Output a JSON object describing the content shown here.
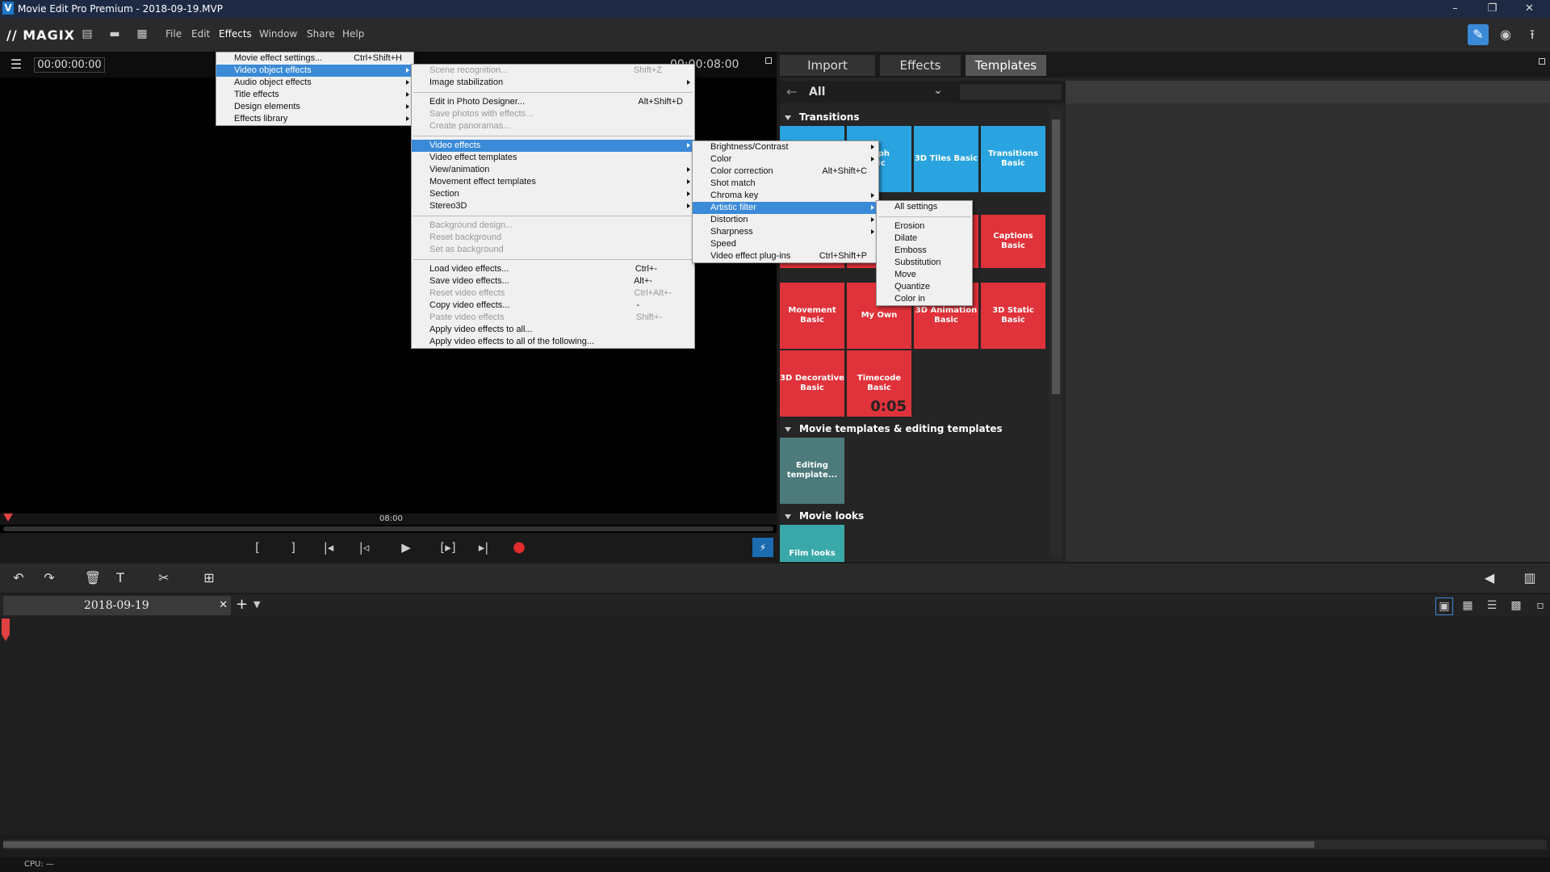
{
  "window": {
    "title": "Movie Edit Pro Premium - 2018-09-19.MVP",
    "app_icon": "V",
    "controls": [
      "–",
      "❐",
      "✕"
    ]
  },
  "menubar": {
    "logo": "// MAGIX",
    "menus": [
      "File",
      "Edit",
      "Effects",
      "Window",
      "Share",
      "Help"
    ],
    "active_menu": "Effects"
  },
  "preview": {
    "timecode": "00:00:00:00",
    "timecode_end": "00:00:08:00",
    "timeline_mark": "08:00"
  },
  "panel": {
    "tabs": [
      "Import",
      "Effects",
      "Templates"
    ],
    "active_tab": "Templates",
    "filter_label": "All",
    "sections": {
      "transitions": "Transitions",
      "movie_templates": "Movie templates & editing templates",
      "movie_looks": "Movie looks"
    },
    "tiles": {
      "morph": "orph\nsic",
      "tiles3d": "3D Tiles Basic",
      "transitions_basic": "Transitions Basic",
      "captions": "Captions Basic",
      "movement": "Movement Basic",
      "my_own": "My Own",
      "anim3d": "3D Animation Basic",
      "static3d": "3D Static Basic",
      "decorative3d": "3D Decorative Basic",
      "timecode": "Timecode Basic",
      "timecode_digits": "0:05",
      "editing": "Editing template...",
      "film_looks": "Film looks"
    }
  },
  "project": {
    "tab_name": "2018-09-19",
    "close": "✕",
    "add": "+"
  },
  "status": {
    "cpu": "CPU: —"
  },
  "effects_menu": [
    {
      "label": "Movie effect settings...",
      "shortcut": "Ctrl+Shift+H"
    },
    {
      "label": "Video object effects",
      "submenu": true,
      "selected": true
    },
    {
      "label": "Audio object effects",
      "submenu": true
    },
    {
      "label": "Title effects",
      "submenu": true
    },
    {
      "label": "Design elements",
      "submenu": true
    },
    {
      "label": "Effects library",
      "submenu": true
    }
  ],
  "video_object_menu": {
    "group1": [
      {
        "label": "Scene recognition...",
        "shortcut": "Shift+Z",
        "disabled": true
      },
      {
        "label": "Image stabilization",
        "submenu": true
      }
    ],
    "group2": [
      {
        "label": "Edit in Photo Designer...",
        "shortcut": "Alt+Shift+D"
      },
      {
        "label": "Save photos with effects...",
        "disabled": true
      },
      {
        "label": "Create panoramas...",
        "disabled": true
      }
    ],
    "group3": [
      {
        "label": "Video effects",
        "submenu": true,
        "selected": true
      },
      {
        "label": "Video effect templates"
      },
      {
        "label": "View/animation",
        "submenu": true
      },
      {
        "label": "Movement effect templates",
        "submenu": true
      },
      {
        "label": "Section",
        "submenu": true
      },
      {
        "label": "Stereo3D",
        "submenu": true
      }
    ],
    "group4": [
      {
        "label": "Background design...",
        "disabled": true
      },
      {
        "label": "Reset background",
        "disabled": true
      },
      {
        "label": "Set as background",
        "disabled": true
      }
    ],
    "group5": [
      {
        "label": "Load video effects...",
        "shortcut": "Ctrl+-"
      },
      {
        "label": "Save video effects...",
        "shortcut": "Alt+-"
      },
      {
        "label": "Reset video effects",
        "shortcut": "Ctrl+Alt+-",
        "disabled": true
      },
      {
        "label": "Copy video effects...",
        "shortcut": "-"
      },
      {
        "label": "Paste video effects",
        "shortcut": "Shift+-",
        "disabled": true
      },
      {
        "label": "Apply video effects to all..."
      },
      {
        "label": "Apply video effects to all of the following..."
      }
    ]
  },
  "video_effects_menu": [
    {
      "label": "Brightness/Contrast",
      "submenu": true
    },
    {
      "label": "Color",
      "submenu": true
    },
    {
      "label": "Color correction",
      "shortcut": "Alt+Shift+C"
    },
    {
      "label": "Shot match"
    },
    {
      "label": "Chroma key",
      "submenu": true
    },
    {
      "label": "Artistic filter",
      "submenu": true,
      "selected": true
    },
    {
      "label": "Distortion",
      "submenu": true
    },
    {
      "label": "Sharpness",
      "submenu": true
    },
    {
      "label": "Speed"
    },
    {
      "label": "Video effect plug-ins",
      "shortcut": "Ctrl+Shift+P"
    }
  ],
  "artistic_filter_menu": {
    "top": [
      {
        "label": "All settings"
      }
    ],
    "items": [
      {
        "label": "Erosion"
      },
      {
        "label": "Dilate"
      },
      {
        "label": "Emboss"
      },
      {
        "label": "Substitution"
      },
      {
        "label": "Move"
      },
      {
        "label": "Quantize"
      },
      {
        "label": "Color in"
      }
    ]
  },
  "colors": {
    "accent": "#3a8ad8",
    "tile_blue": "#2aa4e0",
    "tile_red": "#e0323a",
    "record": "#e02c2c"
  }
}
